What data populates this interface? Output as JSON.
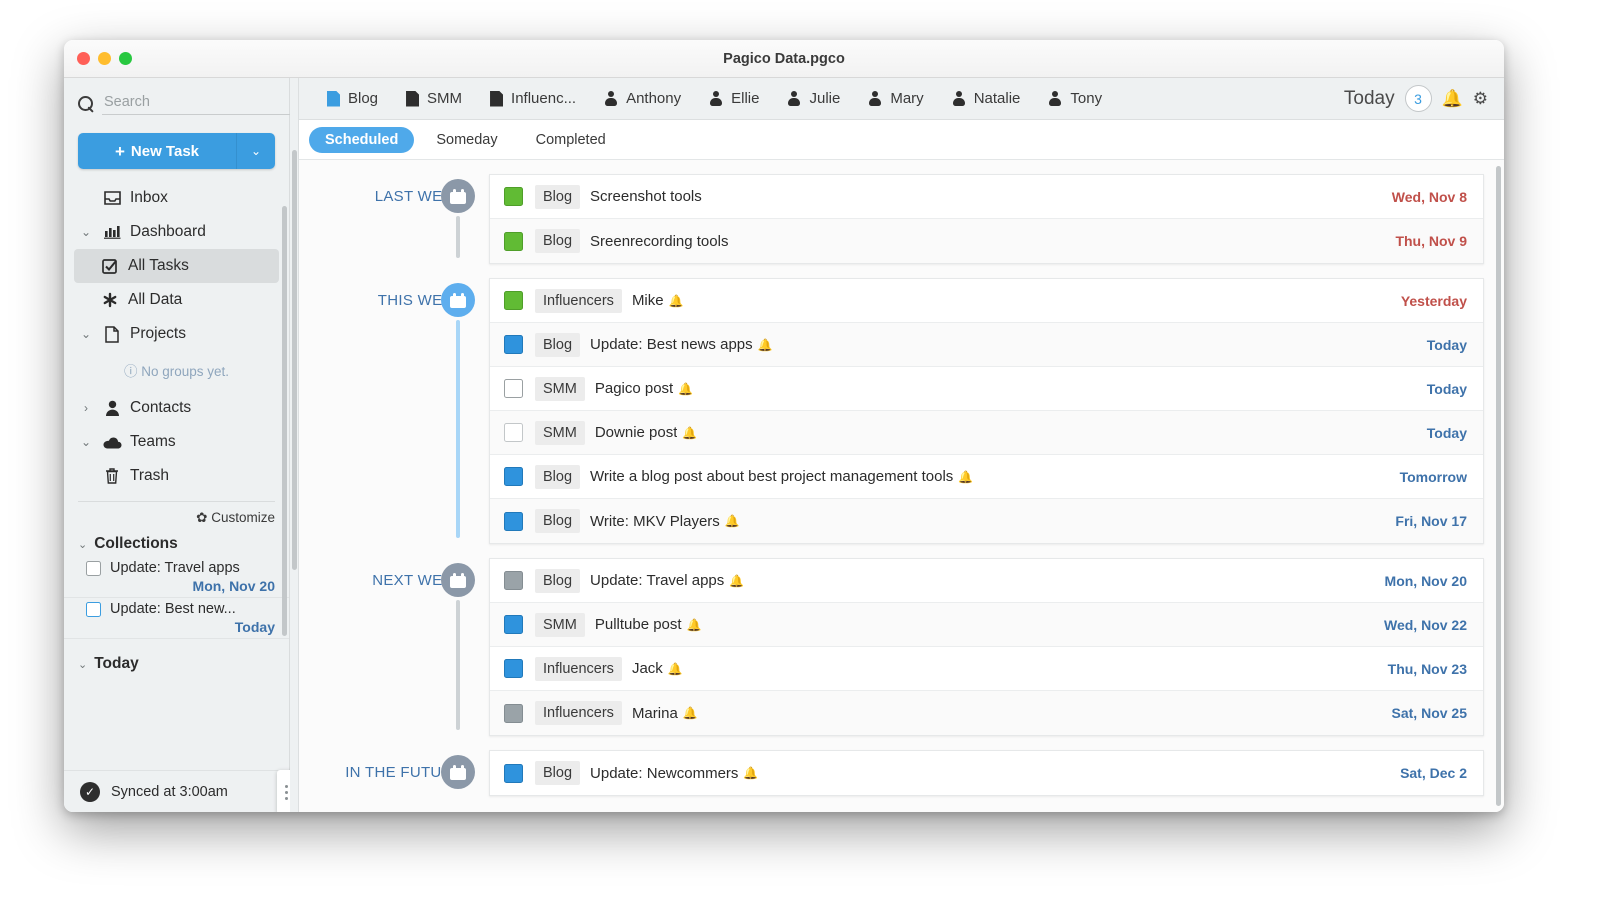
{
  "window": {
    "title": "Pagico Data.pgco"
  },
  "sidebar": {
    "search": {
      "placeholder": "Search",
      "value": ""
    },
    "new_task": {
      "label": "New Task",
      "plus": "+",
      "caret": "⌄"
    },
    "nav": [
      {
        "label": "Inbox",
        "icon": "inbox-icon",
        "chevron": "",
        "selected": false,
        "indent": false
      },
      {
        "label": "Dashboard",
        "icon": "chart-icon",
        "chevron": "⌄",
        "selected": false,
        "indent": false
      },
      {
        "label": "All Tasks",
        "icon": "checkbox-checked-icon",
        "chevron": "",
        "selected": true,
        "indent": true
      },
      {
        "label": "All Data",
        "icon": "asterisk-icon",
        "chevron": "",
        "selected": false,
        "indent": true
      },
      {
        "label": "Projects",
        "icon": "page-icon",
        "chevron": "⌄",
        "selected": false,
        "indent": false
      }
    ],
    "no_groups": "No groups yet.",
    "no_groups_icon": "ⓘ",
    "nav2": [
      {
        "label": "Contacts",
        "icon": "person-icon",
        "chevron": "›",
        "selected": false,
        "indent": false
      },
      {
        "label": "Teams",
        "icon": "cloud-icon",
        "chevron": "⌄",
        "selected": false,
        "indent": false
      },
      {
        "label": "Trash",
        "icon": "trash-icon",
        "chevron": "",
        "selected": false,
        "indent": false
      }
    ],
    "customize": {
      "label": "Customize",
      "icon": "gear-icon"
    },
    "collections": {
      "label": "Collections",
      "chevron": "⌄",
      "items": [
        {
          "title": "Update: Travel apps",
          "date": "Mon, Nov 20",
          "checked": false,
          "accent": "gray"
        },
        {
          "title": "Update: Best new...",
          "date": "Today",
          "checked": false,
          "accent": "blue"
        }
      ]
    },
    "today_group": {
      "label": "Today",
      "chevron": "⌄"
    },
    "status": {
      "text": "Synced at 3:00am",
      "icon": "check-circle-icon"
    },
    "drag_handle": "drag-handle-icon"
  },
  "header": {
    "project_tabs": [
      {
        "label": "Blog",
        "icon": "document-icon",
        "active": true
      },
      {
        "label": "SMM",
        "icon": "document-icon",
        "active": false
      },
      {
        "label": "Influenc...",
        "icon": "document-icon",
        "active": false
      },
      {
        "label": "Anthony",
        "icon": "person-icon",
        "active": false
      },
      {
        "label": "Ellie",
        "icon": "person-icon",
        "active": false
      },
      {
        "label": "Julie",
        "icon": "person-icon",
        "active": false
      },
      {
        "label": "Mary",
        "icon": "person-icon",
        "active": false
      },
      {
        "label": "Natalie",
        "icon": "person-icon",
        "active": false
      },
      {
        "label": "Tony",
        "icon": "person-icon",
        "active": false
      }
    ],
    "today": {
      "label": "Today",
      "count": "3"
    },
    "bell": "🔔",
    "gear": "⚙"
  },
  "subtabs": [
    {
      "label": "Scheduled",
      "active": true
    },
    {
      "label": "Someday",
      "active": false
    },
    {
      "label": "Completed",
      "active": false
    }
  ],
  "groups": [
    {
      "label": "LAST WEEK",
      "circle": "gray",
      "tasks": [
        {
          "state": "green",
          "tag": "Blog",
          "title": "Screenshot tools",
          "bell": false,
          "date": "Wed, Nov 8",
          "overdue": true
        },
        {
          "state": "green",
          "tag": "Blog",
          "title": "Sreenrecording tools",
          "bell": false,
          "date": "Thu, Nov 9",
          "overdue": true
        }
      ]
    },
    {
      "label": "THIS WEEK",
      "circle": "blue",
      "tasks": [
        {
          "state": "green",
          "tag": "Influencers",
          "title": "Mike",
          "bell": true,
          "date": "Yesterday",
          "overdue": true
        },
        {
          "state": "blue",
          "tag": "Blog",
          "title": "Update: Best news apps",
          "bell": true,
          "date": "Today",
          "overdue": false
        },
        {
          "state": "empty",
          "tag": "SMM",
          "title": "Pagico post",
          "bell": true,
          "date": "Today",
          "overdue": false
        },
        {
          "state": "light",
          "tag": "SMM",
          "title": "Downie post",
          "bell": true,
          "date": "Today",
          "overdue": false
        },
        {
          "state": "blue",
          "tag": "Blog",
          "title": "Write a blog post about best project management tools",
          "bell": true,
          "date": "Tomorrow",
          "overdue": false
        },
        {
          "state": "blue",
          "tag": "Blog",
          "title": "Write: MKV Players",
          "bell": true,
          "date": "Fri, Nov 17",
          "overdue": false
        }
      ]
    },
    {
      "label": "NEXT WEEK",
      "circle": "gray",
      "tasks": [
        {
          "state": "gray",
          "tag": "Blog",
          "title": "Update: Travel apps",
          "bell": true,
          "date": "Mon, Nov 20",
          "overdue": false
        },
        {
          "state": "blue",
          "tag": "SMM",
          "title": "Pulltube post",
          "bell": true,
          "date": "Wed, Nov 22",
          "overdue": false
        },
        {
          "state": "blue",
          "tag": "Influencers",
          "title": "Jack",
          "bell": true,
          "date": "Thu, Nov 23",
          "overdue": false
        },
        {
          "state": "gray",
          "tag": "Influencers",
          "title": "Marina",
          "bell": true,
          "date": "Sat, Nov 25",
          "overdue": false
        }
      ]
    },
    {
      "label": "IN THE FUTURE",
      "circle": "gray",
      "tasks": [
        {
          "state": "blue",
          "tag": "Blog",
          "title": "Update: Newcommers",
          "bell": true,
          "date": "Sat, Dec 2",
          "overdue": false
        }
      ]
    }
  ],
  "colors": {
    "accent": "#3b9de0",
    "done": "#61bb34",
    "progress": "#2f93dd",
    "muted": "#9aa3a8",
    "overdue": "#c0504a",
    "link": "#3e72aa"
  }
}
